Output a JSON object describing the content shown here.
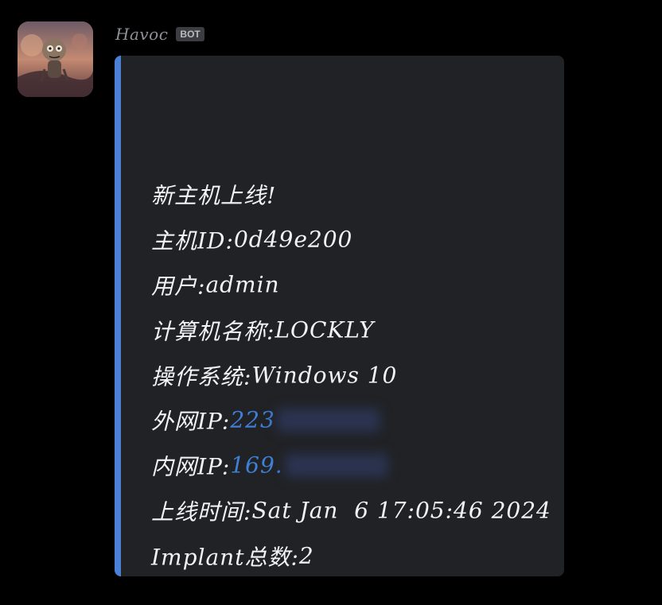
{
  "author": {
    "name": "Havoc",
    "badge": "BOT"
  },
  "embed": {
    "accent_color": "#4a80d6",
    "lines": [
      {
        "label": "新主机上线!",
        "value": ""
      },
      {
        "label": "主机ID: ",
        "value": "0d49e200"
      },
      {
        "label": "用户: ",
        "value": "admin"
      },
      {
        "label": "计算机名称: ",
        "value": "LOCKLY"
      },
      {
        "label": "操作系统: ",
        "value": "Windows 10"
      },
      {
        "label": "外网IP: ",
        "value": "223",
        "link": true,
        "redacted": true
      },
      {
        "label": "内网IP: ",
        "value": "169.",
        "link": true,
        "redacted": true
      },
      {
        "label": "上线时间: ",
        "value": "Sat Jan  6 17:05:46 2024"
      },
      {
        "label": "Implant总数: ",
        "value": "2"
      }
    ]
  },
  "colors": {
    "background": "#000000",
    "embed_background": "#202225",
    "link": "#3f7fd6"
  }
}
